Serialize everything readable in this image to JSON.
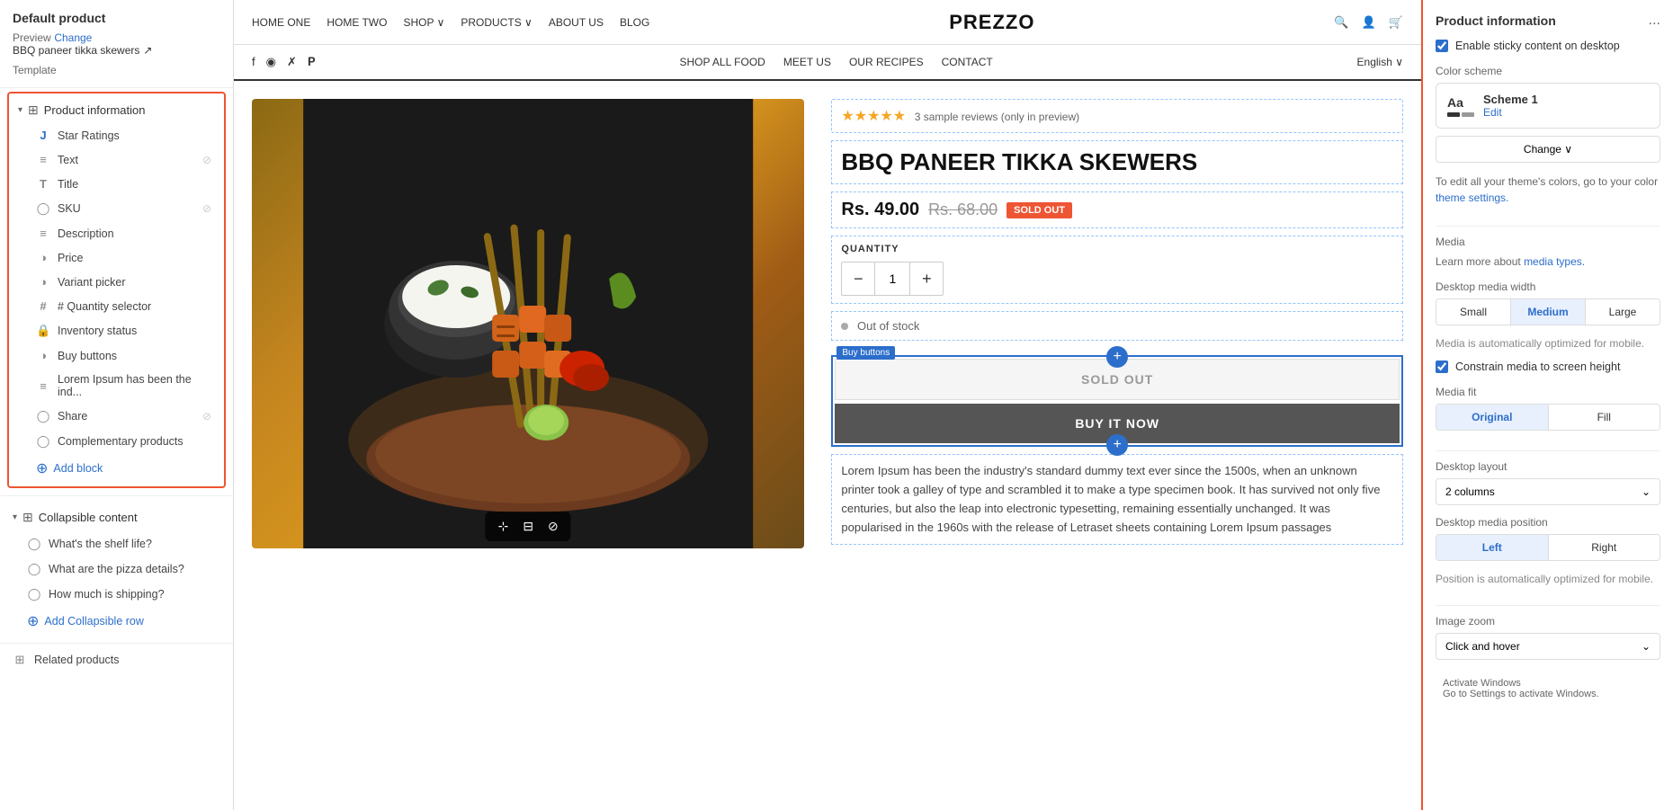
{
  "leftSidebar": {
    "title": "Default product",
    "preview": {
      "label": "Preview",
      "value": "BBQ paneer tikka skewers",
      "change_link": "Change"
    },
    "template_label": "Template",
    "sections": [
      {
        "id": "product-information",
        "label": "Product information",
        "highlighted": true,
        "items": [
          {
            "id": "star-ratings",
            "label": "Star Ratings",
            "icon": "J",
            "icon_type": "letter",
            "has_eye": false
          },
          {
            "id": "text",
            "label": "Text",
            "icon": "≡",
            "has_eye": true
          },
          {
            "id": "title",
            "label": "Title",
            "icon": "T",
            "has_eye": false
          },
          {
            "id": "sku",
            "label": "SKU",
            "icon": "◯",
            "has_eye": true
          },
          {
            "id": "description",
            "label": "Description",
            "icon": "≡",
            "has_eye": false
          },
          {
            "id": "price",
            "label": "Price",
            "icon": "◑",
            "has_eye": false
          },
          {
            "id": "variant-picker",
            "label": "Variant picker",
            "icon": "◑",
            "has_eye": false
          },
          {
            "id": "quantity-selector",
            "label": "# Quantity selector",
            "icon": "#",
            "has_eye": false
          },
          {
            "id": "inventory-status",
            "label": "Inventory status",
            "icon": "🔒",
            "has_eye": false
          },
          {
            "id": "buy-buttons",
            "label": "Buy buttons",
            "icon": "◑",
            "has_eye": false
          },
          {
            "id": "lorem-ipsum",
            "label": "Lorem Ipsum has been the ind...",
            "icon": "≡",
            "has_eye": false
          },
          {
            "id": "share",
            "label": "Share",
            "icon": "◯",
            "has_eye": true
          },
          {
            "id": "complementary-products",
            "label": "Complementary products",
            "icon": "◯",
            "has_eye": false
          }
        ],
        "add_block_label": "Add block"
      }
    ],
    "collapsible_section": {
      "label": "Collapsible content",
      "items": [
        {
          "id": "shelf-life",
          "label": "What's the shelf life?",
          "icon": "◯"
        },
        {
          "id": "pizza-details",
          "label": "What are the pizza details?",
          "icon": "◯"
        },
        {
          "id": "shipping",
          "label": "How much is shipping?",
          "icon": "◯"
        }
      ],
      "add_row_label": "Add Collapsible row"
    },
    "related_products": "Related products"
  },
  "storeNav": {
    "links": [
      "HOME ONE",
      "HOME TWO",
      "SHOP ∨",
      "PRODUCTS ∨",
      "ABOUT US",
      "BLOG"
    ],
    "logo": "PREZZO",
    "icons": [
      "🔍",
      "👤",
      "🛒"
    ]
  },
  "secondaryNav": {
    "social": [
      "f",
      "◉",
      "✗",
      "𝐏"
    ],
    "links": [
      "SHOP ALL FOOD",
      "MEET US",
      "OUR RECIPES",
      "CONTACT"
    ],
    "lang": "English ∨"
  },
  "product": {
    "reviews": "3 sample reviews (only in preview)",
    "title": "BBQ PANEER TIKKA SKEWERS",
    "price_current": "Rs. 49.00",
    "price_original": "Rs. 68.00",
    "sold_out_badge": "SOLD OUT",
    "quantity_label": "QUANTITY",
    "quantity_value": "1",
    "out_of_stock": "Out of stock",
    "buy_buttons_label": "Buy buttons",
    "sold_out_btn": "SOLD OUT",
    "buy_now_btn": "BUY IT NOW",
    "lorem": "Lorem Ipsum has been the industry's standard dummy text ever since the 1500s, when an unknown printer took a galley of type and scrambled it to make a type specimen book. It has survived not only five centuries, but also the leap into electronic typesetting, remaining essentially unchanged. It was popularised in the 1960s with the release of Letraset sheets containing Lorem Ipsum passages"
  },
  "rightSidebar": {
    "title": "Product information",
    "more_btn": "...",
    "sticky_label": "Enable sticky content on desktop",
    "color_scheme_label": "Color scheme",
    "scheme": {
      "name": "Scheme 1",
      "edit": "Edit"
    },
    "change_btn": "Change ∨",
    "helper_text_1": "To edit all your theme's colors, go to your color ",
    "theme_settings_link": "theme settings.",
    "media_label": "Media",
    "media_link": "media types.",
    "media_learn": "Learn more about ",
    "desktop_width_label": "Desktop media width",
    "width_options": [
      "Small",
      "Medium",
      "Large"
    ],
    "media_auto_text": "Media is automatically optimized for mobile.",
    "constrain_label": "Constrain media to screen height",
    "media_fit_label": "Media fit",
    "fit_options": [
      "Original",
      "Fill"
    ],
    "desktop_layout_label": "Desktop layout",
    "layout_value": "2 columns",
    "desktop_media_position_label": "Desktop media position",
    "position_options": [
      "Left",
      "Right"
    ],
    "position_auto_text": "Position is automatically optimized for mobile.",
    "image_zoom_label": "Image zoom",
    "image_zoom_value": "Click and hover",
    "click_hover_text": "Click and hover"
  }
}
